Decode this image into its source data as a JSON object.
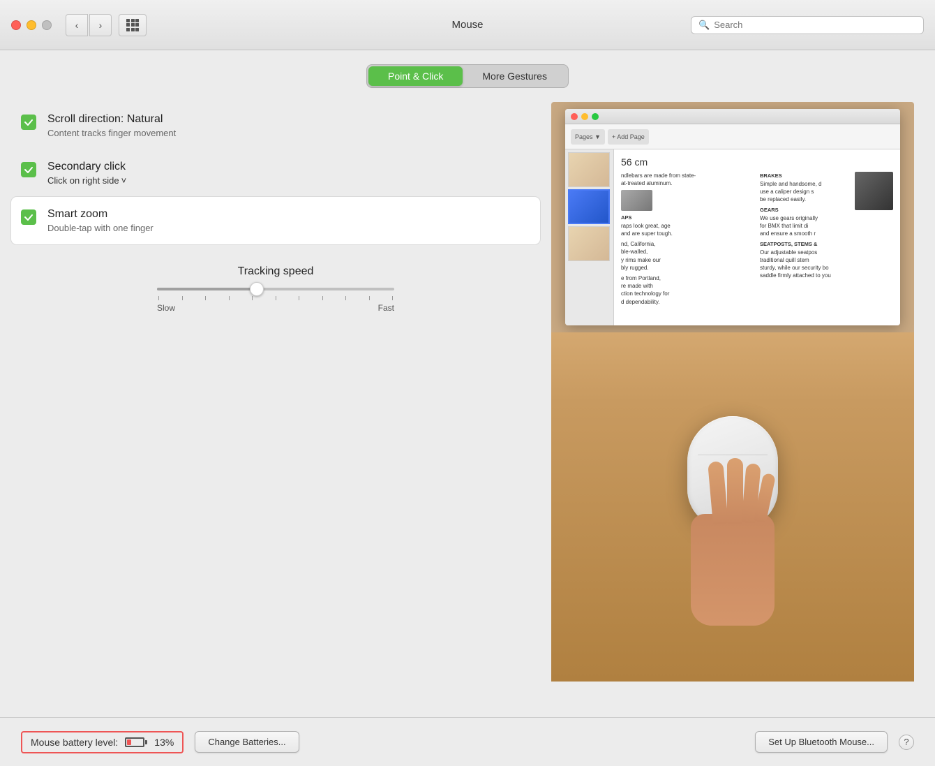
{
  "titlebar": {
    "title": "Mouse",
    "back_button": "‹",
    "forward_button": "›",
    "search_placeholder": "Search"
  },
  "tabs": {
    "point_click": "Point & Click",
    "more_gestures": "More Gestures",
    "active": "point_click"
  },
  "settings": {
    "scroll_direction": {
      "title": "Scroll direction: Natural",
      "subtitle": "Content tracks finger movement",
      "checked": true
    },
    "secondary_click": {
      "title": "Secondary click",
      "subtitle": "Click on right side",
      "checked": true
    },
    "smart_zoom": {
      "title": "Smart zoom",
      "subtitle": "Double-tap with one finger",
      "checked": true
    }
  },
  "tracking_speed": {
    "label": "Tracking speed",
    "slow_label": "Slow",
    "fast_label": "Fast",
    "value": 42
  },
  "status_bar": {
    "battery_label": "Mouse battery level:",
    "battery_percent": "13%",
    "change_batteries_btn": "Change Batteries...",
    "setup_bluetooth_btn": "Set Up Bluetooth Mouse...",
    "help_btn": "?"
  },
  "colors": {
    "accent_green": "#5bbf4a",
    "battery_red": "#e55555"
  }
}
